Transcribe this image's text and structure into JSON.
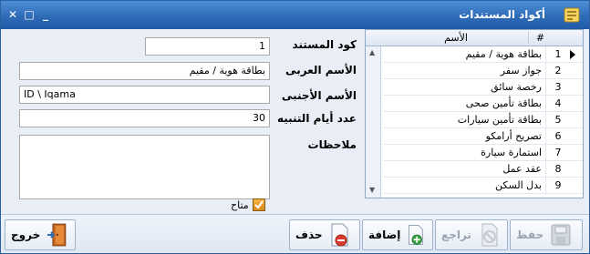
{
  "window": {
    "title": "أكواد المستندات",
    "colors": {
      "title_bar": "#2f6cb8",
      "body": "#e9eef6",
      "delete_red": "#d93a2b",
      "add_green": "#3aa043",
      "checkbox": "#e9a02a"
    }
  },
  "form": {
    "doc_code": {
      "label": "كود المستند",
      "value": "1"
    },
    "arabic_name": {
      "label": "الأسم العربى",
      "value": "بطاقة هوية / مقيم"
    },
    "foreign_name": {
      "label": "الأسم الأجنبى",
      "value": "ID \\ Iqama"
    },
    "alert_days": {
      "label": "عدد أيام التنبيه",
      "value": "30"
    },
    "notes": {
      "label": "ملاحظات",
      "value": ""
    },
    "available": {
      "label": "متاح",
      "checked": true
    }
  },
  "grid": {
    "headers": {
      "num": "#",
      "name": "الأسم"
    },
    "rows": [
      {
        "num": "1",
        "name": "بطاقة هوية / مقيم",
        "selected": true
      },
      {
        "num": "2",
        "name": "جواز سفر"
      },
      {
        "num": "3",
        "name": "رخصة سائق"
      },
      {
        "num": "4",
        "name": "بطاقة تأمين صحى"
      },
      {
        "num": "5",
        "name": "بطاقة تأمين سيارات"
      },
      {
        "num": "6",
        "name": "تصريح أرامكو"
      },
      {
        "num": "7",
        "name": "استمارة سيارة"
      },
      {
        "num": "8",
        "name": "عقد عمل"
      },
      {
        "num": "9",
        "name": "بدل السكن"
      }
    ]
  },
  "toolbar": {
    "save": "حفظ",
    "undo": "تراجع",
    "add": "إضافة",
    "delete": "حذف",
    "exit": "خروج"
  }
}
